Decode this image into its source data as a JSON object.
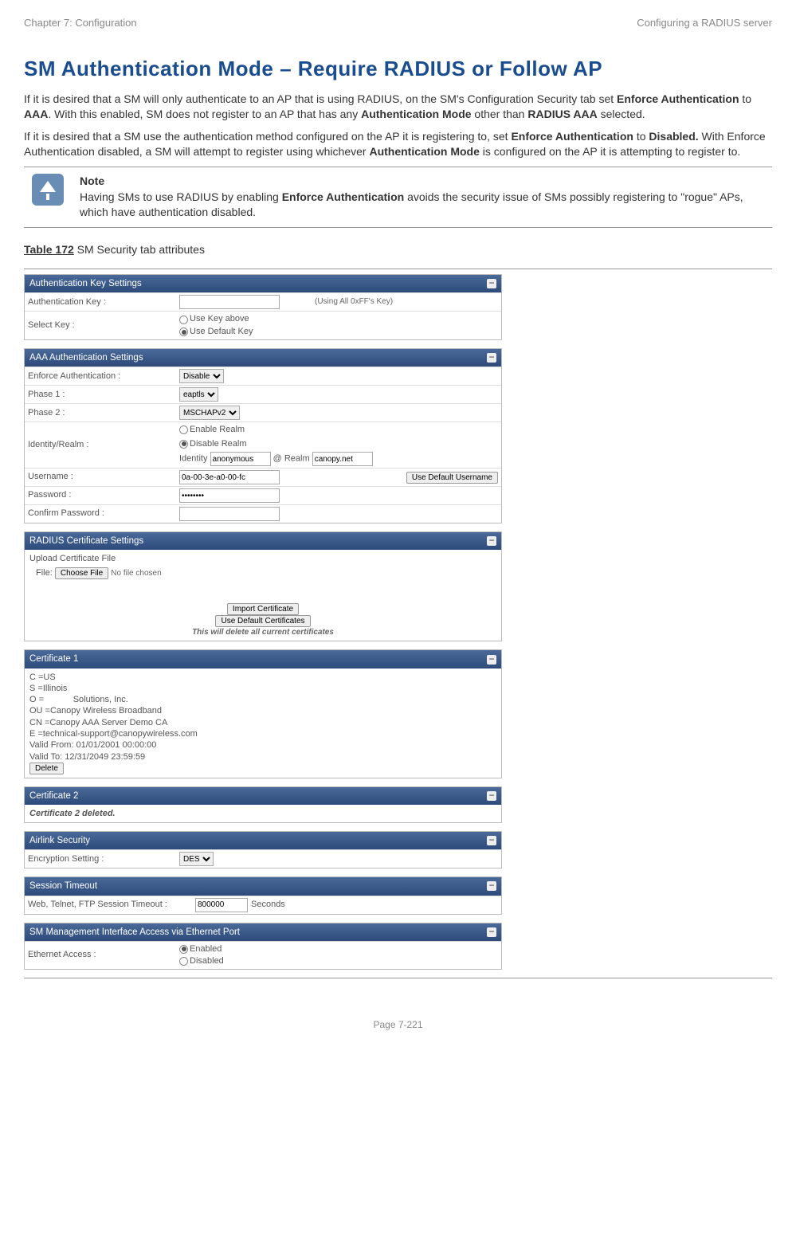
{
  "header": {
    "left": "Chapter 7:  Configuration",
    "right": "Configuring a RADIUS server"
  },
  "title": "SM Authentication Mode – Require RADIUS or Follow AP",
  "para1_a": "If it is desired that a SM will only authenticate to an AP that is using RADIUS, on the SM's Configuration Security tab set ",
  "para1_b": "Enforce Authentication",
  "para1_c": " to ",
  "para1_d": "AAA",
  "para1_e": ". With this enabled, SM does not register to an AP that has any ",
  "para1_f": "Authentication Mode",
  "para1_g": " other than ",
  "para1_h": "RADIUS AAA",
  "para1_i": " selected.",
  "para2_a": "If it is desired that a SM use the authentication method configured on the AP it is registering to, set ",
  "para2_b": "Enforce Authentication",
  "para2_c": " to ",
  "para2_d": "Disabled.",
  "para2_e": " With Enforce Authentication disabled, a SM will attempt to register using whichever ",
  "para2_f": "Authentication Mode",
  "para2_g": " is configured on the AP it is attempting to register to.",
  "note": {
    "title": "Note",
    "body_a": "Having SMs to use RADIUS by enabling ",
    "body_b": "Enforce Authentication",
    "body_c": " avoids the security issue of SMs possibly registering to \"rogue\" APs, which have authentication disabled."
  },
  "table_caption_a": "Table 172",
  "table_caption_b": " SM Security tab attributes",
  "ui": {
    "authKey": {
      "header": "Authentication Key Settings",
      "row1_label": "Authentication Key :",
      "row1_hint": "(Using All 0xFF's Key)",
      "row2_label": "Select Key :",
      "opt1": "Use Key above",
      "opt2": "Use Default Key"
    },
    "aaa": {
      "header": "AAA Authentication Settings",
      "enforce_label": "Enforce Authentication :",
      "enforce_value": "Disable",
      "phase1_label": "Phase 1 :",
      "phase1_value": "eaptls",
      "phase2_label": "Phase 2 :",
      "phase2_value": "MSCHAPv2",
      "realm_label": "Identity/Realm :",
      "realm_opt1": "Enable Realm",
      "realm_opt2": "Disable Realm",
      "identity_label": "Identity",
      "identity_value": "anonymous",
      "at": "@",
      "realm_field_label": "Realm",
      "realm_value": "canopy.net",
      "username_label": "Username :",
      "username_value": "0a-00-3e-a0-00-fc",
      "username_btn": "Use Default Username",
      "password_label": "Password :",
      "password_value": "********",
      "confirm_label": "Confirm Password :"
    },
    "radius": {
      "header": "RADIUS Certificate Settings",
      "upload_label": "Upload Certificate File",
      "file_label": "File:",
      "choose_btn": "Choose File",
      "no_file": "No file chosen",
      "import_btn": "Import Certificate",
      "default_btn": "Use Default Certificates",
      "warn": "This will delete all current certificates"
    },
    "cert1": {
      "header": "Certificate 1",
      "l1": "C =US",
      "l2": "S =Illinois",
      "l3": "O =            Solutions, Inc.",
      "l4": "OU =Canopy Wireless Broadband",
      "l5": "CN =Canopy AAA Server Demo CA",
      "l6": "E =technical-support@canopywireless.com",
      "l7": "Valid From: 01/01/2001 00:00:00",
      "l8": "Valid To: 12/31/2049 23:59:59",
      "delete_btn": "Delete"
    },
    "cert2": {
      "header": "Certificate 2",
      "body": "Certificate 2 deleted."
    },
    "airlink": {
      "header": "Airlink Security",
      "label": "Encryption Setting :",
      "value": "DES"
    },
    "session": {
      "header": "Session Timeout",
      "label": "Web, Telnet, FTP Session Timeout :",
      "value": "800000",
      "unit": "Seconds"
    },
    "sm_mgmt": {
      "header": "SM Management Interface Access via Ethernet Port",
      "label": "Ethernet Access :",
      "opt1": "Enabled",
      "opt2": "Disabled"
    }
  },
  "footer": "Page 7-221"
}
